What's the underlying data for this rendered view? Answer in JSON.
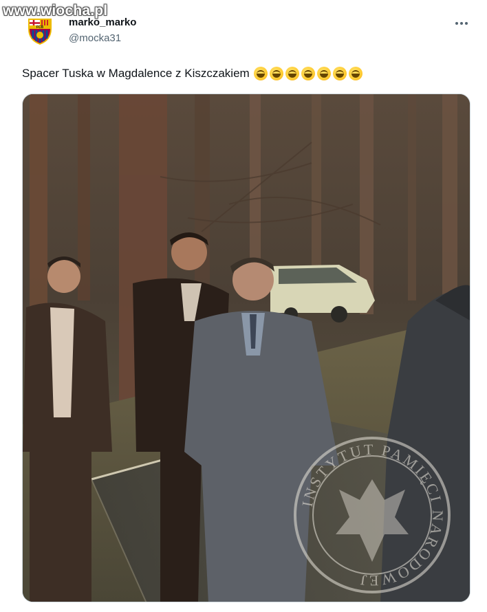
{
  "watermark": {
    "text": "www.wiocha.pl"
  },
  "tweet": {
    "author": {
      "display_name": "marko_marko",
      "handle": "@mocka31",
      "avatar_icon": "fc-barcelona-crest-icon",
      "avatar_text": "FCB"
    },
    "more_icon": "more-dots-icon",
    "text": "Spacer Tuska w Magdalence z Kiszczakiem",
    "emojis": [
      "grinning-face-smiling-eyes",
      "grinning-face-smiling-eyes",
      "grinning-face-smiling-eyes",
      "grinning-squinting-face",
      "grinning-squinting-face",
      "grinning-face-smiling-eyes",
      "grinning-face-smiling-eyes"
    ],
    "media": {
      "kind": "video-still",
      "stamp_text": "INSTYTUT PAMIĘCI NARODOWEJ"
    }
  },
  "colors": {
    "text_primary": "#0f1419",
    "text_secondary": "#536471",
    "border": "#cfd9de"
  }
}
